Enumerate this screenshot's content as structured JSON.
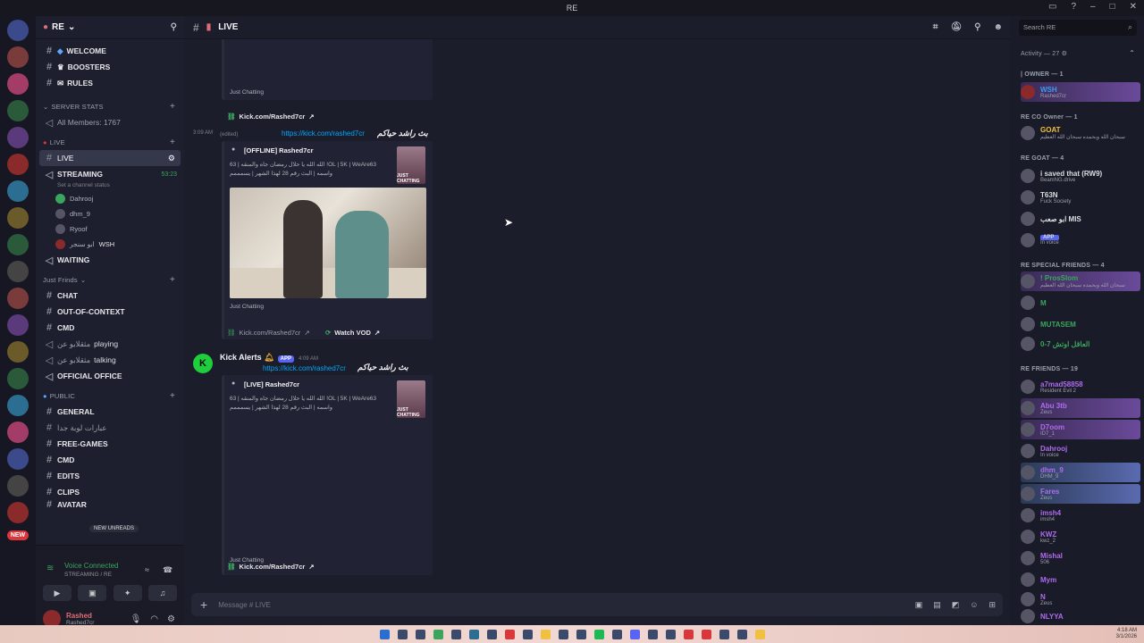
{
  "window": {
    "title": "RE"
  },
  "server": {
    "name": "RE"
  },
  "channels": {
    "top": [
      {
        "name": "WELCOME",
        "prefix": "◆"
      },
      {
        "name": "BOOSTERS",
        "prefix": "♛"
      },
      {
        "name": "RULES",
        "prefix": "✉"
      }
    ],
    "server_stats": {
      "category": "SERVER STATS",
      "member_count": "All Members: 1767"
    },
    "live_category": "LIVE",
    "live_channel": "LIVE",
    "streaming": {
      "name": "STREAMING",
      "time": "53:23",
      "status": "Set a channel status"
    },
    "voice_users": [
      "Dahrooj",
      "dhm_9",
      "Ryoof",
      "ابو سنجر"
    ],
    "voice_user_tag": "WSH",
    "waiting": "WAITING",
    "friends_category": "Just Frinds",
    "friends": [
      {
        "type": "text",
        "name": "CHAT"
      },
      {
        "type": "text",
        "name": "OUT-OF-CONTEXT"
      },
      {
        "type": "text",
        "name": "CMD"
      },
      {
        "type": "voice",
        "name": "playing",
        "users": "مثقلابو عن"
      },
      {
        "type": "voice",
        "name": "talking",
        "users": "مثقلابو عن"
      },
      {
        "type": "voice",
        "name": "OFFICIAL OFFICE"
      }
    ],
    "public_category": "PUBLIC",
    "public": [
      "GENERAL",
      "عبارات لوبة جدا",
      "FREE-GAMES",
      "CMD",
      "EDITS",
      "CLIPS",
      "AVATAR"
    ],
    "new_unreads": "NEW UNREADS"
  },
  "voice": {
    "connected": "Voice Connected",
    "channel": "STREAMING / RE"
  },
  "user": {
    "name": "Rashed",
    "tag": "Rashed7cr"
  },
  "header": {
    "channel": "LIVE"
  },
  "messages": {
    "embed1": {
      "game": "Just Chatting",
      "link_label": "Kick.com/Rashed7cr"
    },
    "msg2": {
      "time": "3:09 AM",
      "edited": "(edited)",
      "url": "https://kick.com/rashed7cr",
      "arabic": "بث راشد حياكم",
      "embed_title": "[OFFLINE] Rashed7cr",
      "embed_desc1": "الله الله يا حلال رمضان جاه والمنقه | 63 !OL | 5K | WeAre63",
      "embed_desc2": "واسمه | البث رقم 28 لهذا الشهر | يسمممم",
      "game": "Just Chatting",
      "link_label": "Kick.com/Rashed7cr",
      "watch_vod": "Watch VOD",
      "boxart": "JUST CHATTING"
    },
    "msg3": {
      "author": "Kick Alerts",
      "badge": "APP",
      "time": "4:09 AM",
      "url": "https://kick.com/rashed7cr",
      "arabic": "بث راشد حياكم",
      "embed_title": "[LIVE] Rashed7cr",
      "embed_desc1": "الله الله يا حلال رمضان جاه والمنقه | 63 !OL | 5K | WeAre63",
      "embed_desc2": "واسمه | البث رقم 28 لهذا الشهر | يسمممم",
      "game": "Just Chatting",
      "link_label": "Kick.com/Rashed7cr",
      "boxart": "JUST CHATTING"
    }
  },
  "composer": {
    "placeholder": "Message # LIVE"
  },
  "members": {
    "search_placeholder": "Search RE",
    "activity": "Activity — 27",
    "groups": [
      {
        "title": "| OWNER — 1",
        "members": [
          {
            "name": "WSH",
            "sub": "Rashed7cr",
            "color": "#3b9cf0"
          }
        ]
      },
      {
        "title": "RE CO Owner — 1",
        "members": [
          {
            "name": "GOAT",
            "sub": "سبحان الله وبحمده سبحان الله العظيم",
            "color": "#f0c040"
          }
        ]
      },
      {
        "title": "RE GOAT — 4",
        "members": [
          {
            "name": "i saved that (RW9)",
            "sub": "BeamNG.drive",
            "color": "#e6e7ea"
          },
          {
            "name": "T63N",
            "sub": "Fuck Society",
            "color": "#e6e7ea"
          },
          {
            "name": "ابو صعب MIS",
            "sub": "",
            "color": "#e6e7ea"
          },
          {
            "name": "APP",
            "sub": "In voice",
            "color": "#e6e7ea"
          }
        ]
      },
      {
        "title": "RE SPECIAL FRIENDS — 4",
        "members": [
          {
            "name": "! ProsSlom",
            "sub": "سبحان الله وبحمده سبحان الله العظيم",
            "color": "#3ba55d"
          },
          {
            "name": "M",
            "sub": "",
            "color": "#3ba55d"
          },
          {
            "name": "MUTASEM",
            "sub": "",
            "color": "#3ba55d"
          },
          {
            "name": "العاقل اوتش 7-0",
            "sub": "",
            "color": "#3ba55d"
          }
        ]
      },
      {
        "title": "RE FRIENDS — 19",
        "members": [
          {
            "name": "a7mad58858",
            "sub": "Resident Evil 2",
            "color": "#b06bf0"
          },
          {
            "name": "Abu 3tb",
            "sub": "Zeus",
            "color": "#b06bf0"
          },
          {
            "name": "D7oom",
            "sub": "ID7_1",
            "color": "#b06bf0"
          },
          {
            "name": "Dahrooj",
            "sub": "In voice",
            "color": "#b06bf0"
          },
          {
            "name": "dhm_9",
            "sub": "DHM_9",
            "color": "#b06bf0"
          },
          {
            "name": "Fares",
            "sub": "Zeus",
            "color": "#b06bf0"
          },
          {
            "name": "imsh4",
            "sub": "imsh4",
            "color": "#b06bf0"
          },
          {
            "name": "KWZ",
            "sub": "kwz_2",
            "color": "#b06bf0"
          },
          {
            "name": "Mishal",
            "sub": "506",
            "color": "#b06bf0"
          },
          {
            "name": "Mym",
            "sub": "",
            "color": "#b06bf0"
          },
          {
            "name": "N",
            "sub": "Zeus",
            "color": "#b06bf0"
          },
          {
            "name": "NLYYA",
            "sub": "",
            "color": "#b06bf0"
          }
        ]
      }
    ]
  },
  "taskbar": {
    "time": "4:18 AM",
    "date": "3/1/2026"
  }
}
